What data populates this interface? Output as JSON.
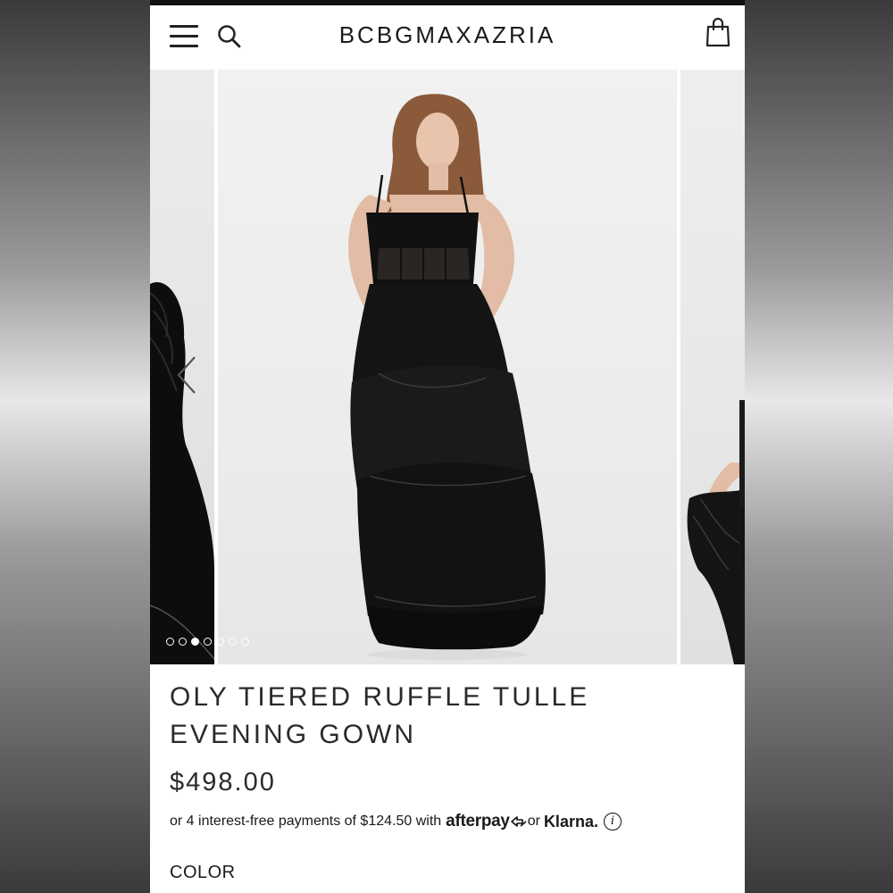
{
  "header": {
    "brand": "BCBGMAXAZRIA",
    "icons": {
      "menu": "hamburger-menu-icon",
      "search": "search-icon",
      "bag": "shopping-bag-icon"
    }
  },
  "gallery": {
    "slide_count": 7,
    "active_index": 2,
    "prev_icon": "chevron-left-icon"
  },
  "product": {
    "title_line1": "OLY TIERED RUFFLE TULLE",
    "title_line2": "EVENING GOWN",
    "price": "$498.00",
    "installments_text": "or 4 interest-free payments of $124.50 with",
    "afterpay_label": "afterpay",
    "or_text": "or",
    "klarna_label": "Klarna.",
    "info_symbol": "i",
    "color_label": "COLOR"
  },
  "colors": {
    "background": "#ffffff",
    "text": "#2a2a2a",
    "dress": "#111111"
  }
}
